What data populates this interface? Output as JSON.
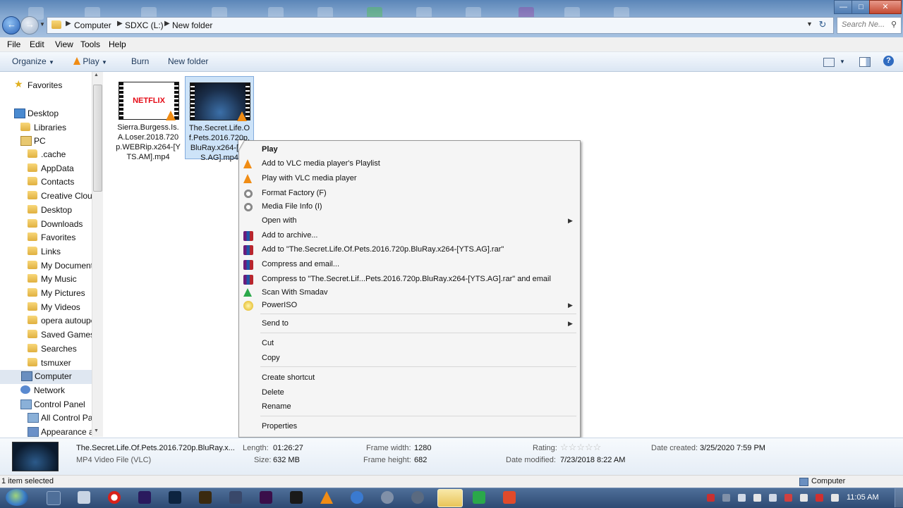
{
  "address": {
    "crumbs": [
      "Computer",
      "SDXC (L:)",
      "New folder"
    ],
    "search_placeholder": "Search Ne..."
  },
  "menubar": [
    "File",
    "Edit",
    "View",
    "Tools",
    "Help"
  ],
  "toolbar": {
    "organize": "Organize",
    "play": "Play",
    "burn": "Burn",
    "new_folder": "New folder"
  },
  "nav": {
    "favorites": "Favorites",
    "desktop": "Desktop",
    "libraries": "Libraries",
    "pc": "PC",
    "pc_items": [
      ".cache",
      "AppData",
      "Contacts",
      "Creative Clouc",
      "Desktop",
      "Downloads",
      "Favorites",
      "Links",
      "My Document",
      "My Music",
      "My Pictures",
      "My Videos",
      "opera autoupc",
      "Saved Games",
      "Searches",
      "tsmuxer"
    ],
    "computer": "Computer",
    "network": "Network",
    "control_panel": "Control Panel",
    "cp_items": [
      "All Control Par",
      "Appearance ar"
    ]
  },
  "files": [
    {
      "name": "Sierra.Burgess.Is.A.Loser.2018.720p.WEBRip.x264-[YTS.AM].mp4",
      "thumb_text": "NETFLIX"
    },
    {
      "name": "The.Secret.Life.Of.Pets.2016.720p.BluRay.x264-[YTS.AG].mp4"
    }
  ],
  "context_menu": {
    "play": "Play",
    "add_vlc_playlist": "Add to VLC media player's Playlist",
    "play_vlc": "Play with VLC media player",
    "format_factory": "Format Factory (F)",
    "media_info": "Media File Info (I)",
    "open_with": "Open with",
    "add_archive": "Add to archive...",
    "add_to_rar": "Add to \"The.Secret.Life.Of.Pets.2016.720p.BluRay.x264-[YTS.AG].rar\"",
    "compress_email": "Compress and email...",
    "compress_to_email": "Compress to \"The.Secret.Lif...Pets.2016.720p.BluRay.x264-[YTS.AG].rar\" and email",
    "scan_smadav": "Scan With Smadav",
    "poweriso": "PowerISO",
    "send_to": "Send to",
    "cut": "Cut",
    "copy": "Copy",
    "create_shortcut": "Create shortcut",
    "delete": "Delete",
    "rename": "Rename",
    "properties": "Properties"
  },
  "details": {
    "file_name": "The.Secret.Life.Of.Pets.2016.720p.BluRay.x...",
    "file_type": "MP4 Video File (VLC)",
    "length_label": "Length:",
    "length": "01:26:27",
    "size_label": "Size:",
    "size": "632 MB",
    "frame_width_label": "Frame width:",
    "frame_width": "1280",
    "frame_height_label": "Frame height:",
    "frame_height": "682",
    "rating_label": "Rating:",
    "rating": 0,
    "date_modified_label": "Date modified:",
    "date_modified": "7/23/2018 8:22 AM",
    "date_created_label": "Date created:",
    "date_created": "3/25/2020 7:59 PM"
  },
  "status": {
    "selected": "1 item selected",
    "location": "Computer"
  },
  "taskbar": {
    "clock": "11:05 AM"
  }
}
